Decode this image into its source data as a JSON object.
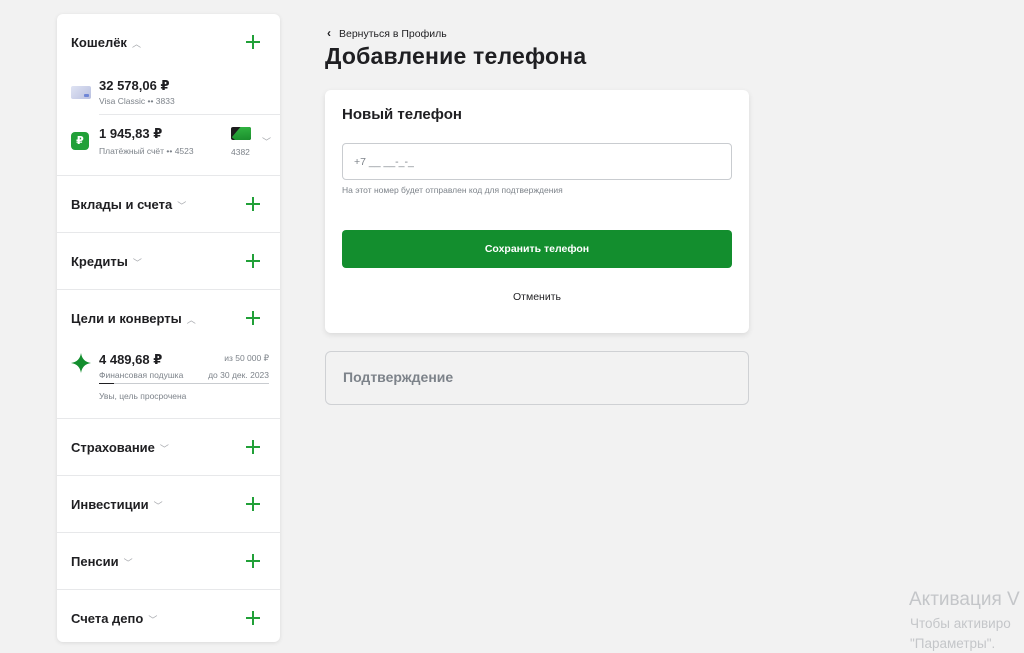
{
  "sidebar": {
    "wallet": {
      "title": "Кошелёк",
      "accounts": [
        {
          "amount": "32 578,06 ₽",
          "sub": "Visa Classic •• 3833"
        },
        {
          "amount": "1 945,83 ₽",
          "sub": "Платёжный счёт •• 4523",
          "card_number": "4382"
        }
      ]
    },
    "deposits": {
      "title": "Вклады и счета"
    },
    "credits": {
      "title": "Кредиты"
    },
    "goals": {
      "title": "Цели и конверты",
      "goal": {
        "amount": "4 489,68 ₽",
        "target": "из 50 000 ₽",
        "name": "Финансовая подушка",
        "deadline": "до 30 дек. 2023",
        "status": "Увы, цель просрочена",
        "progress": 0.09
      }
    },
    "insurance": {
      "title": "Страхование"
    },
    "investments": {
      "title": "Инвестиции"
    },
    "pensions": {
      "title": "Пенсии"
    },
    "depo": {
      "title": "Счета депо"
    }
  },
  "main": {
    "back_label": "Вернуться в Профиль",
    "page_title": "Добавление телефона",
    "card": {
      "title": "Новый телефон",
      "phone_placeholder": "+7 __ __-_-_",
      "hint": "На этот номер будет отправлен код для подтверждения",
      "save_label": "Сохранить телефон",
      "cancel_label": "Отменить"
    },
    "confirm_title": "Подтверждение"
  },
  "watermark": {
    "line1": "Активация V",
    "line2": "Чтобы активиро",
    "line3": "\"Параметры\"."
  },
  "colors": {
    "accent": "#21a038",
    "button": "#138e2e",
    "background": "#f2f2f2"
  }
}
